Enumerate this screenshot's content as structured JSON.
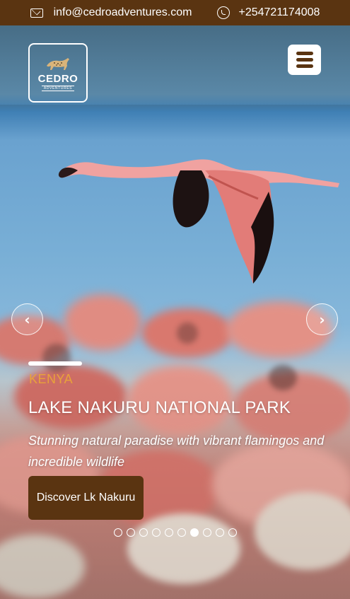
{
  "topbar": {
    "email": "info@cedroadventures.com",
    "phone": "+254721174008",
    "email_icon": "envelope-icon",
    "phone_icon": "whatsapp-icon"
  },
  "logo": {
    "brand": "CEDRO",
    "tagline": "ADVENTURES",
    "icon": "cheetah-icon"
  },
  "nav": {
    "menu_icon": "hamburger-menu-icon"
  },
  "slider": {
    "prev_icon": "chevron-left-icon",
    "next_icon": "chevron-right-icon",
    "prev_glyph": "‹",
    "next_glyph": "›",
    "country": "KENYA",
    "title": "LAKE NAKURU NATIONAL PARK",
    "description": "Stunning natural paradise with vibrant flamingos and incredible wildlife",
    "cta_label": "Discover Lk Nakuru",
    "slide_count": 10,
    "active_index": 6
  },
  "colors": {
    "brand_brown": "#5a3411",
    "accent_orange": "#e8a23a",
    "white": "#ffffff"
  }
}
